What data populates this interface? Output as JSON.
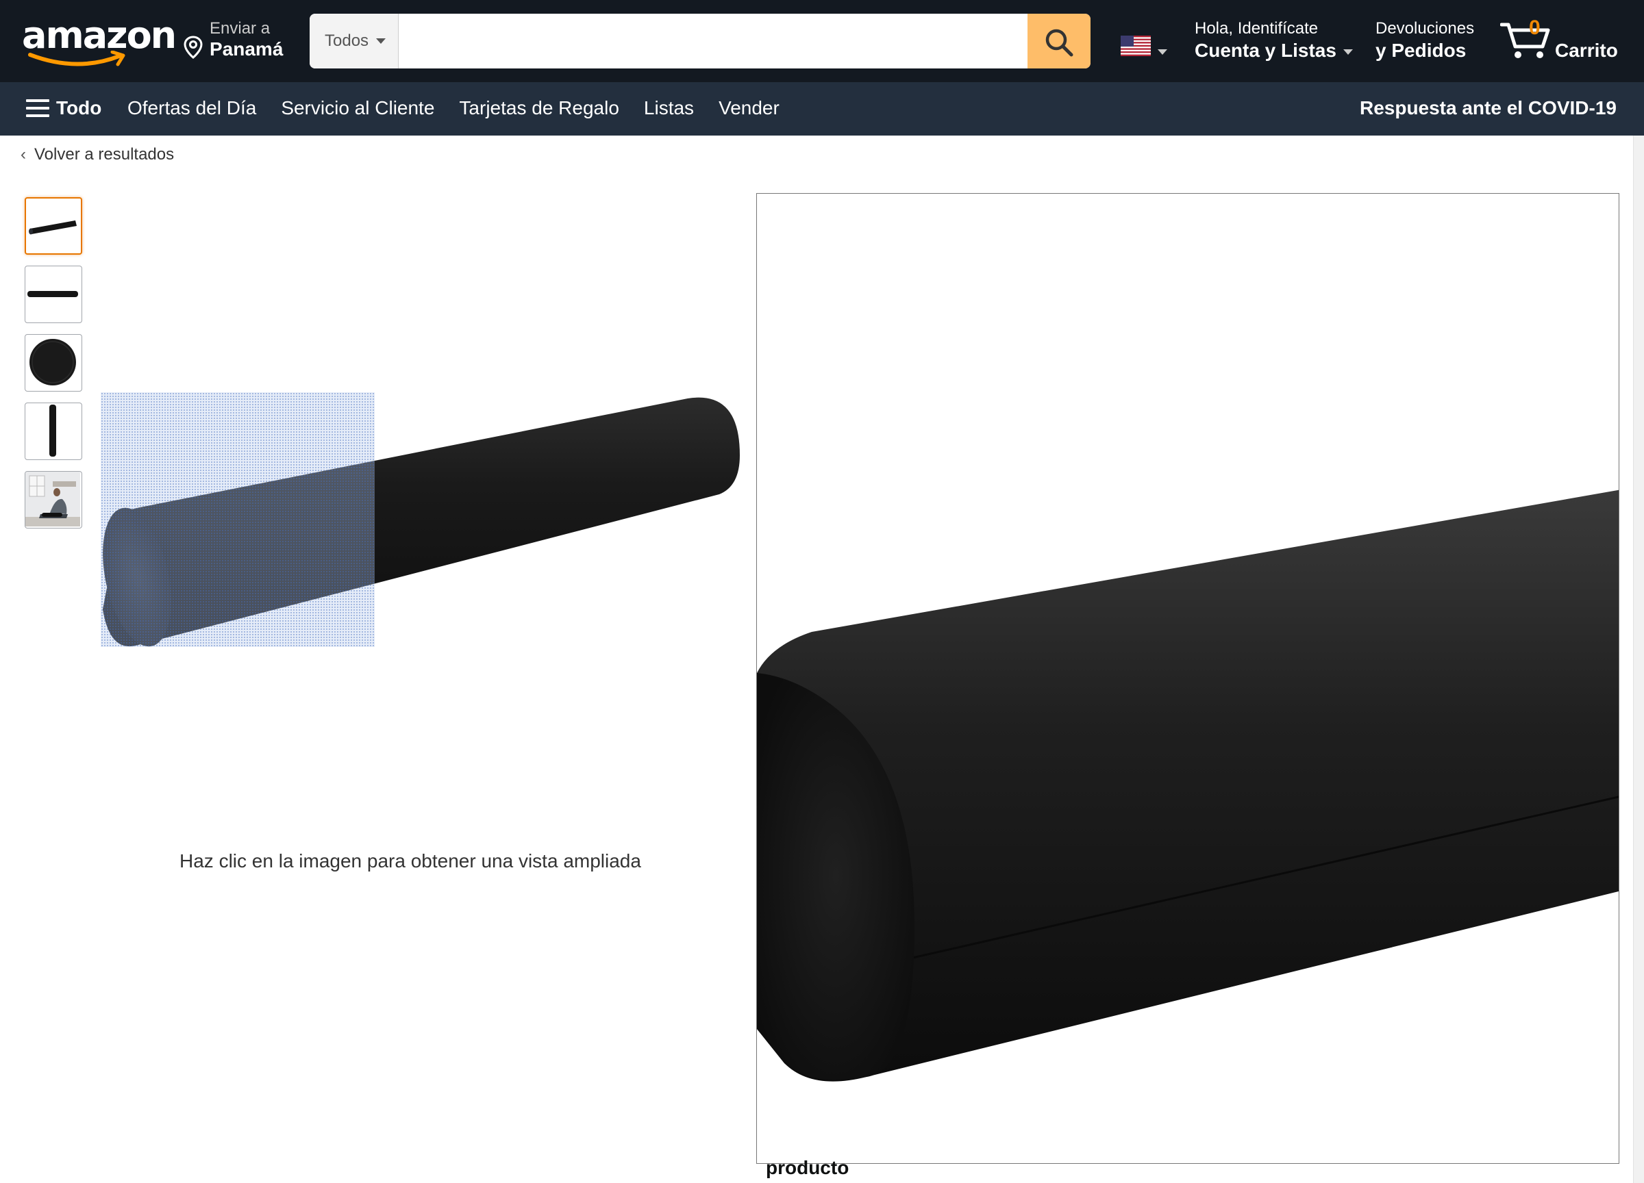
{
  "header": {
    "logo_text": "amazon",
    "deliver": {
      "line1": "Enviar a",
      "line2": "Panamá"
    },
    "search": {
      "category": "Todos",
      "placeholder": "",
      "value": ""
    },
    "locale_flag": "us-flag-icon",
    "account": {
      "line1": "Hola, Identifícate",
      "line2": "Cuenta y Listas"
    },
    "orders": {
      "line1": "Devoluciones",
      "line2": "y Pedidos"
    },
    "cart": {
      "count": "0",
      "label": "Carrito"
    }
  },
  "nav": {
    "all_label": "Todo",
    "links": [
      "Ofertas del Día",
      "Servicio al Cliente",
      "Tarjetas de Regalo",
      "Listas",
      "Vender"
    ],
    "covid": "Respuesta ante el COVID-19"
  },
  "breadcrumb": {
    "back_label": "Volver a resultados"
  },
  "gallery": {
    "thumbnails": [
      "foam-roller-angled",
      "foam-roller-side",
      "foam-roller-end",
      "foam-roller-vertical",
      "person-using-roller"
    ],
    "selected_index": 0,
    "hint": "Haz clic en la imagen para obtener una vista ampliada"
  },
  "zoom": {
    "caption_below": "producto"
  },
  "colors": {
    "nav_top_bg": "#131921",
    "nav_main_bg": "#232f3e",
    "search_button": "#febd69",
    "accent_orange": "#f08804",
    "thumb_selected": "#e77600"
  }
}
